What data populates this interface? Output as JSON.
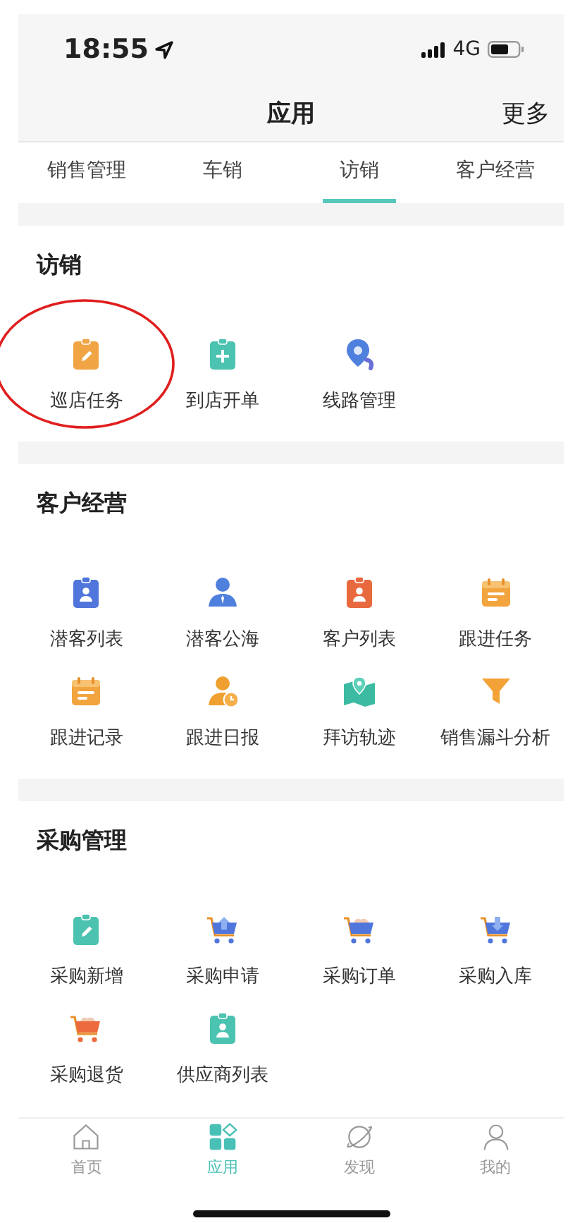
{
  "status_bar": {
    "time": "18:55",
    "network": "4G"
  },
  "header": {
    "title": "应用",
    "action": "更多"
  },
  "tabs": [
    {
      "label": "销售管理",
      "selected": false
    },
    {
      "label": "车销",
      "selected": false
    },
    {
      "label": "访销",
      "selected": true
    },
    {
      "label": "客户经营",
      "selected": false
    }
  ],
  "sections": [
    {
      "title": "访销",
      "items": [
        {
          "label": "巡店任务",
          "circled": true
        },
        {
          "label": "到店开单",
          "circled": false
        },
        {
          "label": "线路管理",
          "circled": false
        }
      ]
    },
    {
      "title": "客户经营",
      "items": [
        {
          "label": "潜客列表",
          "circled": false
        },
        {
          "label": "潜客公海",
          "circled": false
        },
        {
          "label": "客户列表",
          "circled": false
        },
        {
          "label": "跟进任务",
          "circled": false
        },
        {
          "label": "跟进记录",
          "circled": false
        },
        {
          "label": "跟进日报",
          "circled": false
        },
        {
          "label": "拜访轨迹",
          "circled": false
        },
        {
          "label": "销售漏斗分析",
          "circled": false
        }
      ]
    },
    {
      "title": "采购管理",
      "items": [
        {
          "label": "采购新增",
          "circled": false
        },
        {
          "label": "采购申请",
          "circled": false
        },
        {
          "label": "采购订单",
          "circled": false
        },
        {
          "label": "采购入库",
          "circled": false
        },
        {
          "label": "采购退货",
          "circled": false
        },
        {
          "label": "供应商列表",
          "circled": false
        }
      ]
    }
  ],
  "bottom_nav": [
    {
      "label": "首页",
      "selected": false
    },
    {
      "label": "应用",
      "selected": true
    },
    {
      "label": "发现",
      "selected": false
    },
    {
      "label": "我的",
      "selected": false
    }
  ]
}
